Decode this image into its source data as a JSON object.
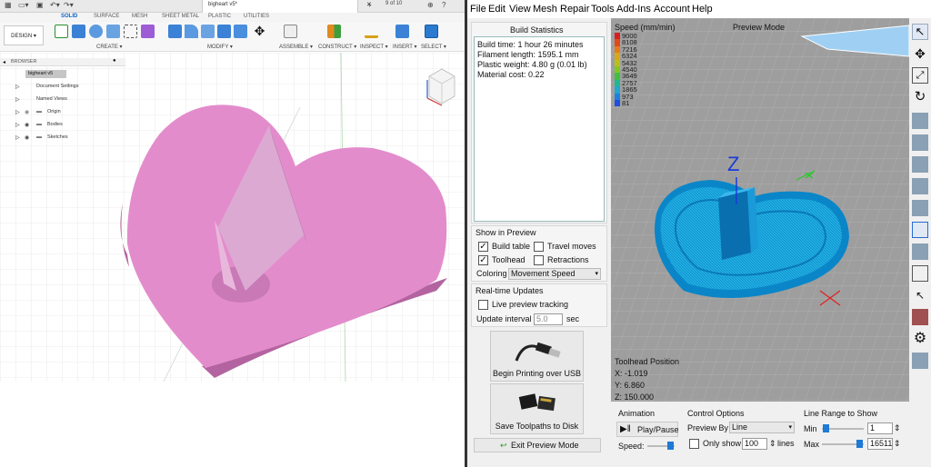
{
  "fusion": {
    "title_tab": "bigheart v5*",
    "tab_counter": "9 of 10",
    "ribbon_tabs": [
      "SOLID",
      "SURFACE",
      "MESH",
      "SHEET METAL",
      "PLASTIC",
      "UTILITIES"
    ],
    "design_button": "DESIGN ▾",
    "groups": [
      "CREATE ▾",
      "MODIFY ▾",
      "ASSEMBLE ▾",
      "CONSTRUCT ▾",
      "INSPECT ▾",
      "INSERT ▾",
      "SELECT ▾"
    ],
    "browser_title": "BROWSER",
    "browser_items": [
      "bigheart v5",
      "Document Settings",
      "Named Views",
      "Origin",
      "Bodies",
      "Sketches"
    ],
    "heart_color": "#e38ccc"
  },
  "repetier": {
    "menu": [
      "File",
      "Edit",
      "View",
      "Mesh",
      "Repair",
      "Tools",
      "Add-Ins",
      "Account",
      "Help"
    ],
    "build_stats": {
      "title": "Build Statistics",
      "lines": [
        "Build time: 1 hour 26 minutes",
        "Filament length: 1595.1 mm",
        "Plastic weight: 4.80 g (0.01 lb)",
        "Material cost: 0.22"
      ]
    },
    "show_in_preview": {
      "title": "Show in Preview",
      "build_table": "Build table",
      "travel_moves": "Travel moves",
      "toolhead": "Toolhead",
      "retractions": "Retractions",
      "coloring_label": "Coloring",
      "coloring_value": "Movement Speed"
    },
    "realtime": {
      "title": "Real-time Updates",
      "live_tracking": "Live preview tracking",
      "interval_label": "Update interval",
      "interval_value": "5.0",
      "interval_unit": "sec"
    },
    "usb_button": "Begin Printing over USB",
    "sd_button": "Save Toolpaths to Disk",
    "exit_button": "Exit Preview Mode",
    "preview": {
      "speed_title": "Speed (mm/min)",
      "mode": "Preview Mode",
      "legend": [
        {
          "v": "9000",
          "c": "#d62020"
        },
        {
          "v": "8108",
          "c": "#e04a1a"
        },
        {
          "v": "7216",
          "c": "#e87a18"
        },
        {
          "v": "6324",
          "c": "#d8a818"
        },
        {
          "v": "5432",
          "c": "#b8c018"
        },
        {
          "v": "4540",
          "c": "#80c820"
        },
        {
          "v": "3649",
          "c": "#40c040"
        },
        {
          "v": "2757",
          "c": "#20b890"
        },
        {
          "v": "1865",
          "c": "#20a8d0"
        },
        {
          "v": "973",
          "c": "#2080e0"
        },
        {
          "v": "81",
          "c": "#1f4fe0"
        }
      ],
      "toolhead_title": "Toolhead Position",
      "x": "X: -1.019",
      "y": "Y: 6.860",
      "z": "Z: 150.000"
    },
    "animation": {
      "title": "Animation",
      "play": "Play/Pause",
      "speed": "Speed:"
    },
    "control": {
      "title": "Control Options",
      "preview_by_label": "Preview By",
      "preview_by_value": "Line",
      "only_show": "Only show",
      "only_value": "100",
      "lines": "lines"
    },
    "range": {
      "title": "Line Range to Show",
      "min_label": "Min",
      "min_value": "1",
      "max_label": "Max",
      "max_value": "16511"
    }
  }
}
